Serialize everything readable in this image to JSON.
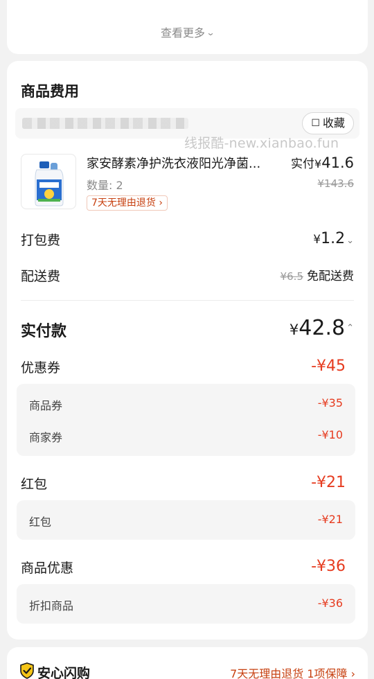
{
  "top_card": {
    "see_more": "查看更多"
  },
  "fees_section": {
    "title": "商品费用",
    "favorite_label": "收藏",
    "watermark": "线报酷-new.xianbao.fun",
    "product": {
      "name": "家安酵素净护洗衣液阳光净菌...",
      "quantity": "数量: 2",
      "return_tag": "7天无理由退货",
      "paid_label": "实付",
      "currency": "¥",
      "paid_amount": "41.6",
      "original_price": "¥143.6"
    },
    "packing_fee": {
      "label": "打包费",
      "currency": "¥",
      "amount": "1.2"
    },
    "delivery_fee": {
      "label": "配送费",
      "original": "¥6.5",
      "free_label": "免配送费"
    },
    "total": {
      "label": "实付款",
      "currency": "¥",
      "amount": "42.8"
    },
    "coupons": {
      "label": "优惠券",
      "amount": "-¥45",
      "items": [
        {
          "label": "商品券",
          "amount": "-¥35"
        },
        {
          "label": "商家券",
          "amount": "-¥10"
        }
      ]
    },
    "red_packet": {
      "label": "红包",
      "amount": "-¥21",
      "items": [
        {
          "label": "红包",
          "amount": "-¥21"
        }
      ]
    },
    "product_discount": {
      "label": "商品优惠",
      "amount": "-¥36",
      "items": [
        {
          "label": "折扣商品",
          "amount": "-¥36"
        }
      ]
    }
  },
  "safe_flash": {
    "title": "安心闪购",
    "guarantee": "7天无理由退货 1项保障"
  },
  "colors": {
    "accent_red": "#e63b1f",
    "tag_orange": "#c74010",
    "shield_yellow": "#f5c518"
  }
}
